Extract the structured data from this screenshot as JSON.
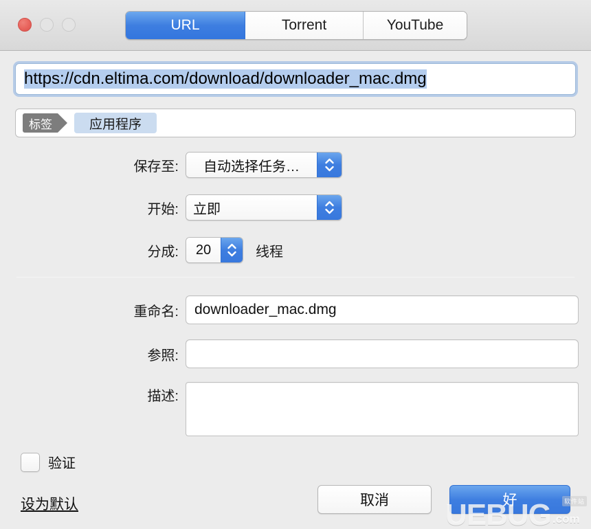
{
  "window": {
    "traffic_lights": {
      "close": "close-button",
      "minimize": "minimize-button",
      "maximize": "maximize-button"
    }
  },
  "tabs": [
    {
      "label": "URL",
      "active": true
    },
    {
      "label": "Torrent",
      "active": false
    },
    {
      "label": "YouTube",
      "active": false
    }
  ],
  "url_field": {
    "value": "https://cdn.eltima.com/download/downloader_mac.dmg",
    "selected": true
  },
  "tag_field": {
    "badge": "标签",
    "token": "应用程序"
  },
  "form": {
    "save_to": {
      "label": "保存至:",
      "value": "自动选择任务…"
    },
    "start": {
      "label": "开始:",
      "value": "立即"
    },
    "split": {
      "label": "分成:",
      "value": "20",
      "suffix": "线程"
    },
    "rename": {
      "label": "重命名:",
      "value": "downloader_mac.dmg"
    },
    "referrer": {
      "label": "参照:",
      "value": ""
    },
    "description": {
      "label": "描述:",
      "value": ""
    }
  },
  "verify": {
    "label": "验证",
    "checked": false
  },
  "set_default_link": "设为默认",
  "buttons": {
    "cancel": "取消",
    "ok": "好"
  },
  "watermark": {
    "text": "UEBUG",
    "suffix": ".com",
    "badge": "软件站"
  },
  "colors": {
    "accent_blue": "#3e7ee0",
    "selection_blue": "#b4cdee",
    "token_blue": "#cbdcf0",
    "badge_gray": "#7d7d7d",
    "window_bg": "#ececec",
    "close_red": "#e8635c"
  }
}
